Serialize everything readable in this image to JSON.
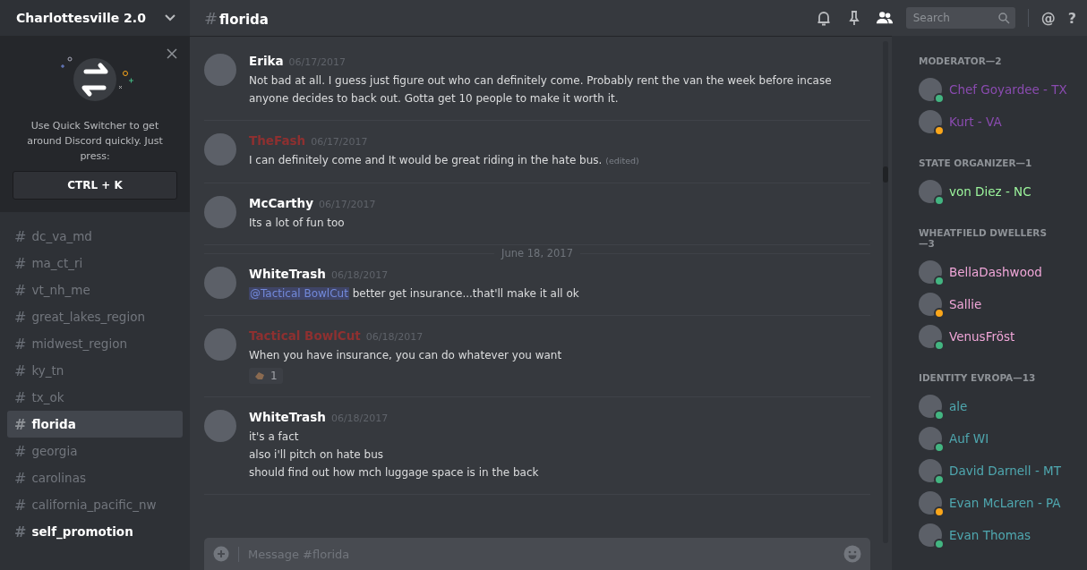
{
  "server": {
    "name": "Charlottesville 2.0"
  },
  "quick_switcher": {
    "text": "Use Quick Switcher to get around Discord quickly. Just press:",
    "shortcut": "CTRL + K"
  },
  "channels": [
    {
      "name": "dc_va_md",
      "selected": false,
      "unread": false
    },
    {
      "name": "ma_ct_ri",
      "selected": false,
      "unread": false
    },
    {
      "name": "vt_nh_me",
      "selected": false,
      "unread": false
    },
    {
      "name": "great_lakes_region",
      "selected": false,
      "unread": false
    },
    {
      "name": "midwest_region",
      "selected": false,
      "unread": false
    },
    {
      "name": "ky_tn",
      "selected": false,
      "unread": false
    },
    {
      "name": "tx_ok",
      "selected": false,
      "unread": false
    },
    {
      "name": "florida",
      "selected": true,
      "unread": false
    },
    {
      "name": "georgia",
      "selected": false,
      "unread": false
    },
    {
      "name": "carolinas",
      "selected": false,
      "unread": false
    },
    {
      "name": "california_pacific_nw",
      "selected": false,
      "unread": false
    },
    {
      "name": "self_promotion",
      "selected": false,
      "unread": true
    }
  ],
  "header": {
    "hash": "#",
    "channel": "florida",
    "search_placeholder": "Search",
    "at": "@",
    "help": "?"
  },
  "messages": [
    {
      "kind": "message",
      "author": "Erika",
      "color": "#ffffff",
      "time": "06/17/2017",
      "lines": [
        {
          "text": "Not bad at all. I guess just figure out who can definitely come. Probably rent the van the week before incase anyone decides to back out. Gotta get 10 people to make it worth it."
        }
      ]
    },
    {
      "kind": "message",
      "author": "TheFash",
      "color": "#8e3030",
      "time": "06/17/2017",
      "lines": [
        {
          "text": "I can definitely come and It would be great riding in the hate bus.",
          "edited": "(edited)"
        }
      ]
    },
    {
      "kind": "message",
      "author": "McCarthy",
      "color": "#ffffff",
      "time": "06/17/2017",
      "lines": [
        {
          "text": "Its a lot of fun too"
        }
      ]
    },
    {
      "kind": "divider",
      "label": "June 18, 2017"
    },
    {
      "kind": "message",
      "author": "WhiteTrash",
      "color": "#ffffff",
      "time": "06/18/2017",
      "lines": [
        {
          "mention": "@Tactical BowlCut",
          "text": " better get insurance...that'll make it all ok"
        }
      ]
    },
    {
      "kind": "message",
      "author": "Tactical BowlCut",
      "color": "#8e3030",
      "time": "06/18/2017",
      "lines": [
        {
          "text": "When you have insurance, you can do whatever you want"
        }
      ],
      "reaction": {
        "count": "1"
      }
    },
    {
      "kind": "message",
      "author": "WhiteTrash",
      "color": "#ffffff",
      "time": "06/18/2017",
      "lines": [
        {
          "text": "it's a fact"
        },
        {
          "text": "also i'll pitch on hate bus"
        },
        {
          "text": "should find out how mch luggage space is in the back"
        }
      ]
    }
  ],
  "composer": {
    "placeholder": "Message #florida"
  },
  "member_groups": [
    {
      "title": "MODERATOR—2",
      "color": "#8a4bb0",
      "members": [
        {
          "name": "Chef Goyardee - TX",
          "color": "#43b581"
        },
        {
          "name": "Kurt - VA",
          "color": "#faa61a"
        }
      ]
    },
    {
      "title": "STATE ORGANIZER—1",
      "color": "#9cf59c",
      "members": [
        {
          "name": "von Diez - NC",
          "color": "#43b581"
        }
      ]
    },
    {
      "title": "WHEATFIELD DWELLERS—3",
      "color": "#f0a6d8",
      "members": [
        {
          "name": "BellaDashwood",
          "color": "#43b581"
        },
        {
          "name": "Sallie",
          "color": "#faa61a"
        },
        {
          "name": "VenusFröst",
          "color": "#43b581"
        }
      ]
    },
    {
      "title": "IDENTITY EVROPA—13",
      "color": "#4fa8b0",
      "members": [
        {
          "name": "ale",
          "color": "#43b581"
        },
        {
          "name": "Auf WI",
          "color": "#43b581"
        },
        {
          "name": "David Darnell - MT",
          "color": "#43b581"
        },
        {
          "name": "Evan McLaren - PA",
          "color": "#faa61a"
        },
        {
          "name": "Evan Thomas",
          "color": "#43b581"
        }
      ]
    }
  ]
}
